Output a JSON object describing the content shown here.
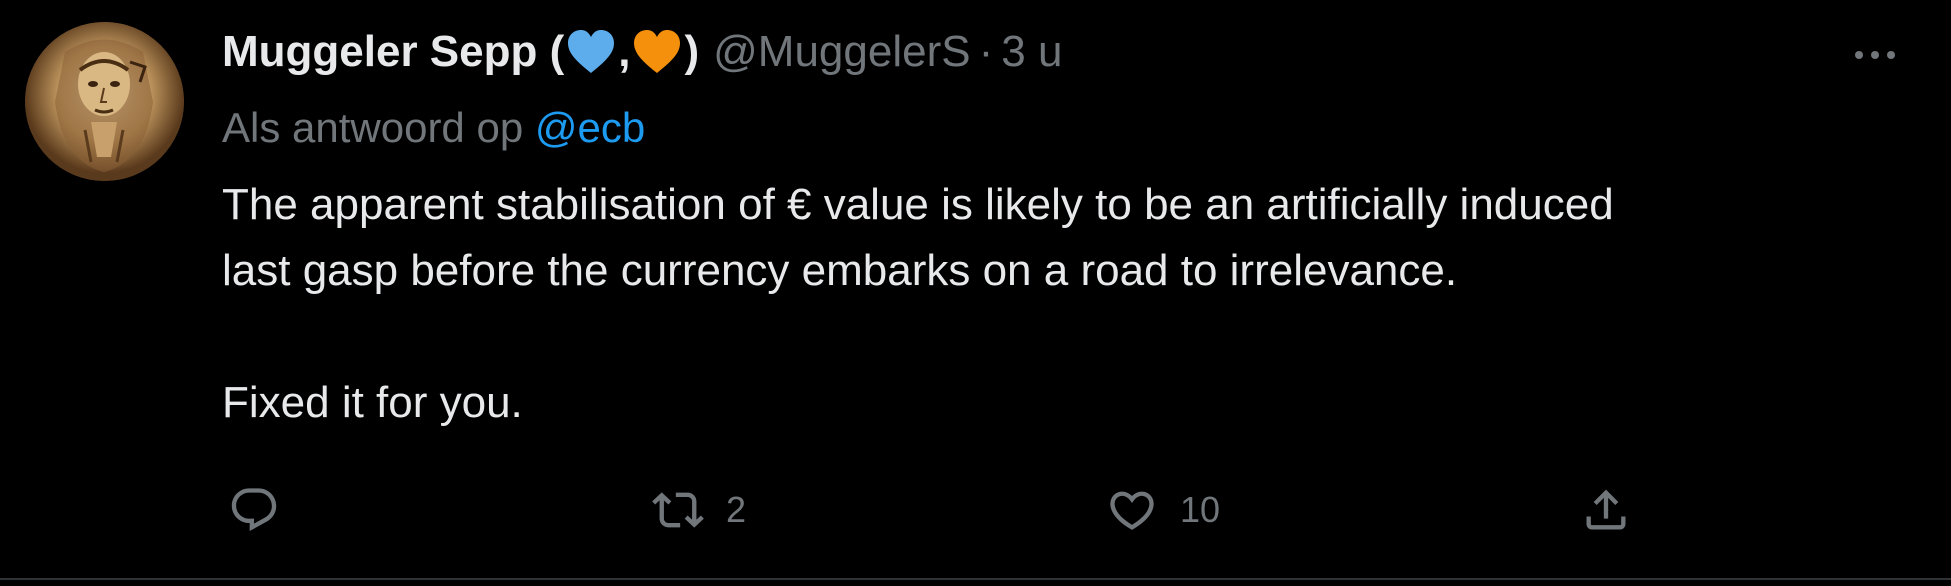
{
  "tweet": {
    "author": {
      "name_prefix": "Muggeler Sepp (",
      "name_separator": ",",
      "name_suffix": ")",
      "handle": "@MuggelerS",
      "dot": "·",
      "time": "3 u",
      "emojis": [
        "blue-heart-icon",
        "orange-heart-icon"
      ]
    },
    "reply_to": {
      "prefix": "Als antwoord op",
      "mention": "@ecb"
    },
    "text": {
      "line1": "The apparent stabilisation of € value is likely to be an artificially induced",
      "line2": "last gasp before the currency embarks on a road to irrelevance.",
      "line3": "Fixed it for you."
    },
    "actions": {
      "reply_count": "",
      "retweet_count": "2",
      "like_count": "10"
    }
  },
  "colors": {
    "background": "#000000",
    "text_primary": "#e7e9ea",
    "text_secondary": "#71767b",
    "link": "#1d9bf0",
    "blue_heart": "#5dadec",
    "orange_heart": "#f4900c",
    "divider": "#2f3336"
  }
}
